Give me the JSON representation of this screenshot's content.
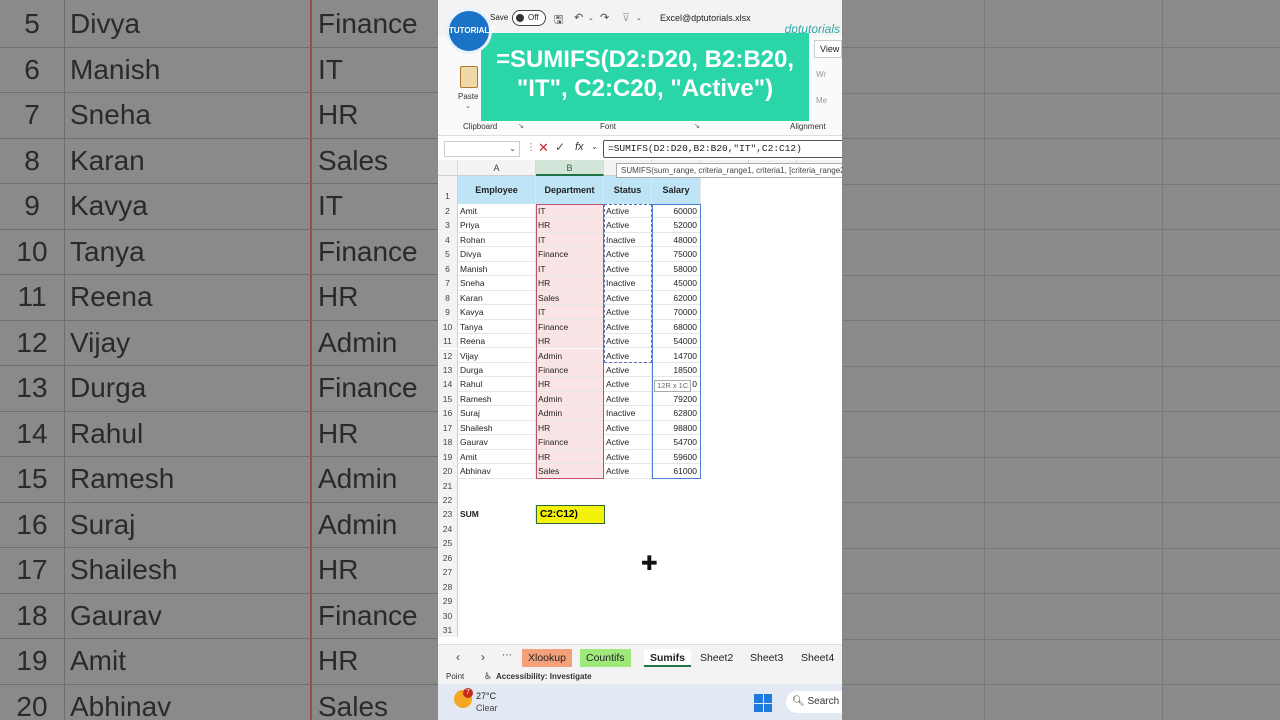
{
  "background_rows": [
    {
      "num": "5",
      "name": "Divya",
      "dept": "Finance"
    },
    {
      "num": "6",
      "name": "Manish",
      "dept": "IT"
    },
    {
      "num": "7",
      "name": "Sneha",
      "dept": "HR"
    },
    {
      "num": "8",
      "name": "Karan",
      "dept": "Sales"
    },
    {
      "num": "9",
      "name": "Kavya",
      "dept": "IT"
    },
    {
      "num": "10",
      "name": "Tanya",
      "dept": "Finance"
    },
    {
      "num": "11",
      "name": "Reena",
      "dept": "HR"
    },
    {
      "num": "12",
      "name": "Vijay",
      "dept": "Admin"
    },
    {
      "num": "13",
      "name": "Durga",
      "dept": "Finance"
    },
    {
      "num": "14",
      "name": "Rahul",
      "dept": "HR"
    },
    {
      "num": "15",
      "name": "Ramesh",
      "dept": "Admin"
    },
    {
      "num": "16",
      "name": "Suraj",
      "dept": "Admin"
    },
    {
      "num": "17",
      "name": "Shailesh",
      "dept": "HR"
    },
    {
      "num": "18",
      "name": "Gaurav",
      "dept": "Finance"
    },
    {
      "num": "19",
      "name": "Amit",
      "dept": "HR"
    },
    {
      "num": "20",
      "name": "Abhinav",
      "dept": "Sales"
    }
  ],
  "titlebar": {
    "logo_text": "TUTORIALS",
    "autosave_label": "Save",
    "autosave_state": "Off",
    "filename": "Excel@dptutorials.xlsx",
    "brand": "dptutorials"
  },
  "ribbon": {
    "paste_label": "Paste",
    "clipboard_label": "Clipboard",
    "font_label": "Font",
    "alignment_label": "Alignment",
    "view_tab": "View",
    "right_item_1": "Wr",
    "right_item_2": "Me"
  },
  "banner": {
    "line1": "=SUMIFS(D2:D20, B2:B20,",
    "line2": "\"IT\", C2:C20, \"Active\")"
  },
  "formula_bar": {
    "namebox_value": "",
    "formula": "=SUMIFS(D2:D20,B2:B20,\"IT\",C2:C12)",
    "tooltip": "SUMIFS(sum_range, criteria_range1, criteria1, [criteria_range2, ...])"
  },
  "columns": [
    "A",
    "B",
    "C",
    "D"
  ],
  "table": {
    "headers": [
      "Employee",
      "Department",
      "Status",
      "Salary"
    ],
    "rows": [
      [
        "Amit",
        "IT",
        "Active",
        "60000"
      ],
      [
        "Priya",
        "HR",
        "Active",
        "52000"
      ],
      [
        "Rohan",
        "IT",
        "Inactive",
        "48000"
      ],
      [
        "Divya",
        "Finance",
        "Active",
        "75000"
      ],
      [
        "Manish",
        "IT",
        "Active",
        "58000"
      ],
      [
        "Sneha",
        "HR",
        "Inactive",
        "45000"
      ],
      [
        "Karan",
        "Sales",
        "Active",
        "62000"
      ],
      [
        "Kavya",
        "IT",
        "Active",
        "70000"
      ],
      [
        "Tanya",
        "Finance",
        "Active",
        "68000"
      ],
      [
        "Reena",
        "HR",
        "Active",
        "54000"
      ],
      [
        "Vijay",
        "Admin",
        "Active",
        "14700"
      ],
      [
        "Durga",
        "Finance",
        "Active",
        "18500"
      ],
      [
        "Rahul",
        "HR",
        "Active",
        "0"
      ],
      [
        "Ramesh",
        "Admin",
        "Active",
        "79200"
      ],
      [
        "Suraj",
        "Admin",
        "Inactive",
        "62800"
      ],
      [
        "Shailesh",
        "HR",
        "Active",
        "98800"
      ],
      [
        "Gaurav",
        "Finance",
        "Active",
        "54700"
      ],
      [
        "Amit",
        "HR",
        "Active",
        "59600"
      ],
      [
        "Abhinav",
        "Sales",
        "Active",
        "61000"
      ]
    ]
  },
  "row_numbers": [
    "1",
    "2",
    "3",
    "4",
    "5",
    "6",
    "7",
    "8",
    "9",
    "10",
    "11",
    "12",
    "13",
    "14",
    "15",
    "16",
    "17",
    "18",
    "19",
    "20",
    "21",
    "22",
    "23",
    "24",
    "25",
    "26",
    "27",
    "28",
    "29",
    "30",
    "31"
  ],
  "sum_row": {
    "label": "SUM",
    "value": "C2:C12)"
  },
  "size_tip": "12R x 1C",
  "sheets": [
    {
      "label": "Xlookup",
      "style": "orange"
    },
    {
      "label": "Countifs",
      "style": "green"
    },
    {
      "label": "Sumifs",
      "style": "active"
    },
    {
      "label": "Sheet2",
      "style": ""
    },
    {
      "label": "Sheet3",
      "style": ""
    },
    {
      "label": "Sheet4",
      "style": ""
    }
  ],
  "status": {
    "mode": "Point",
    "accessibility": "Accessibility: Investigate"
  },
  "taskbar": {
    "badge": "7",
    "temp": "27°C",
    "condition": "Clear",
    "search": "Search"
  },
  "colors": {
    "banner": "#2ad6a8",
    "sum_highlight": "#f5f20a",
    "header_fill": "#bfe4f5",
    "dept_fill": "#fbe4e6",
    "excel_green": "#217346"
  }
}
